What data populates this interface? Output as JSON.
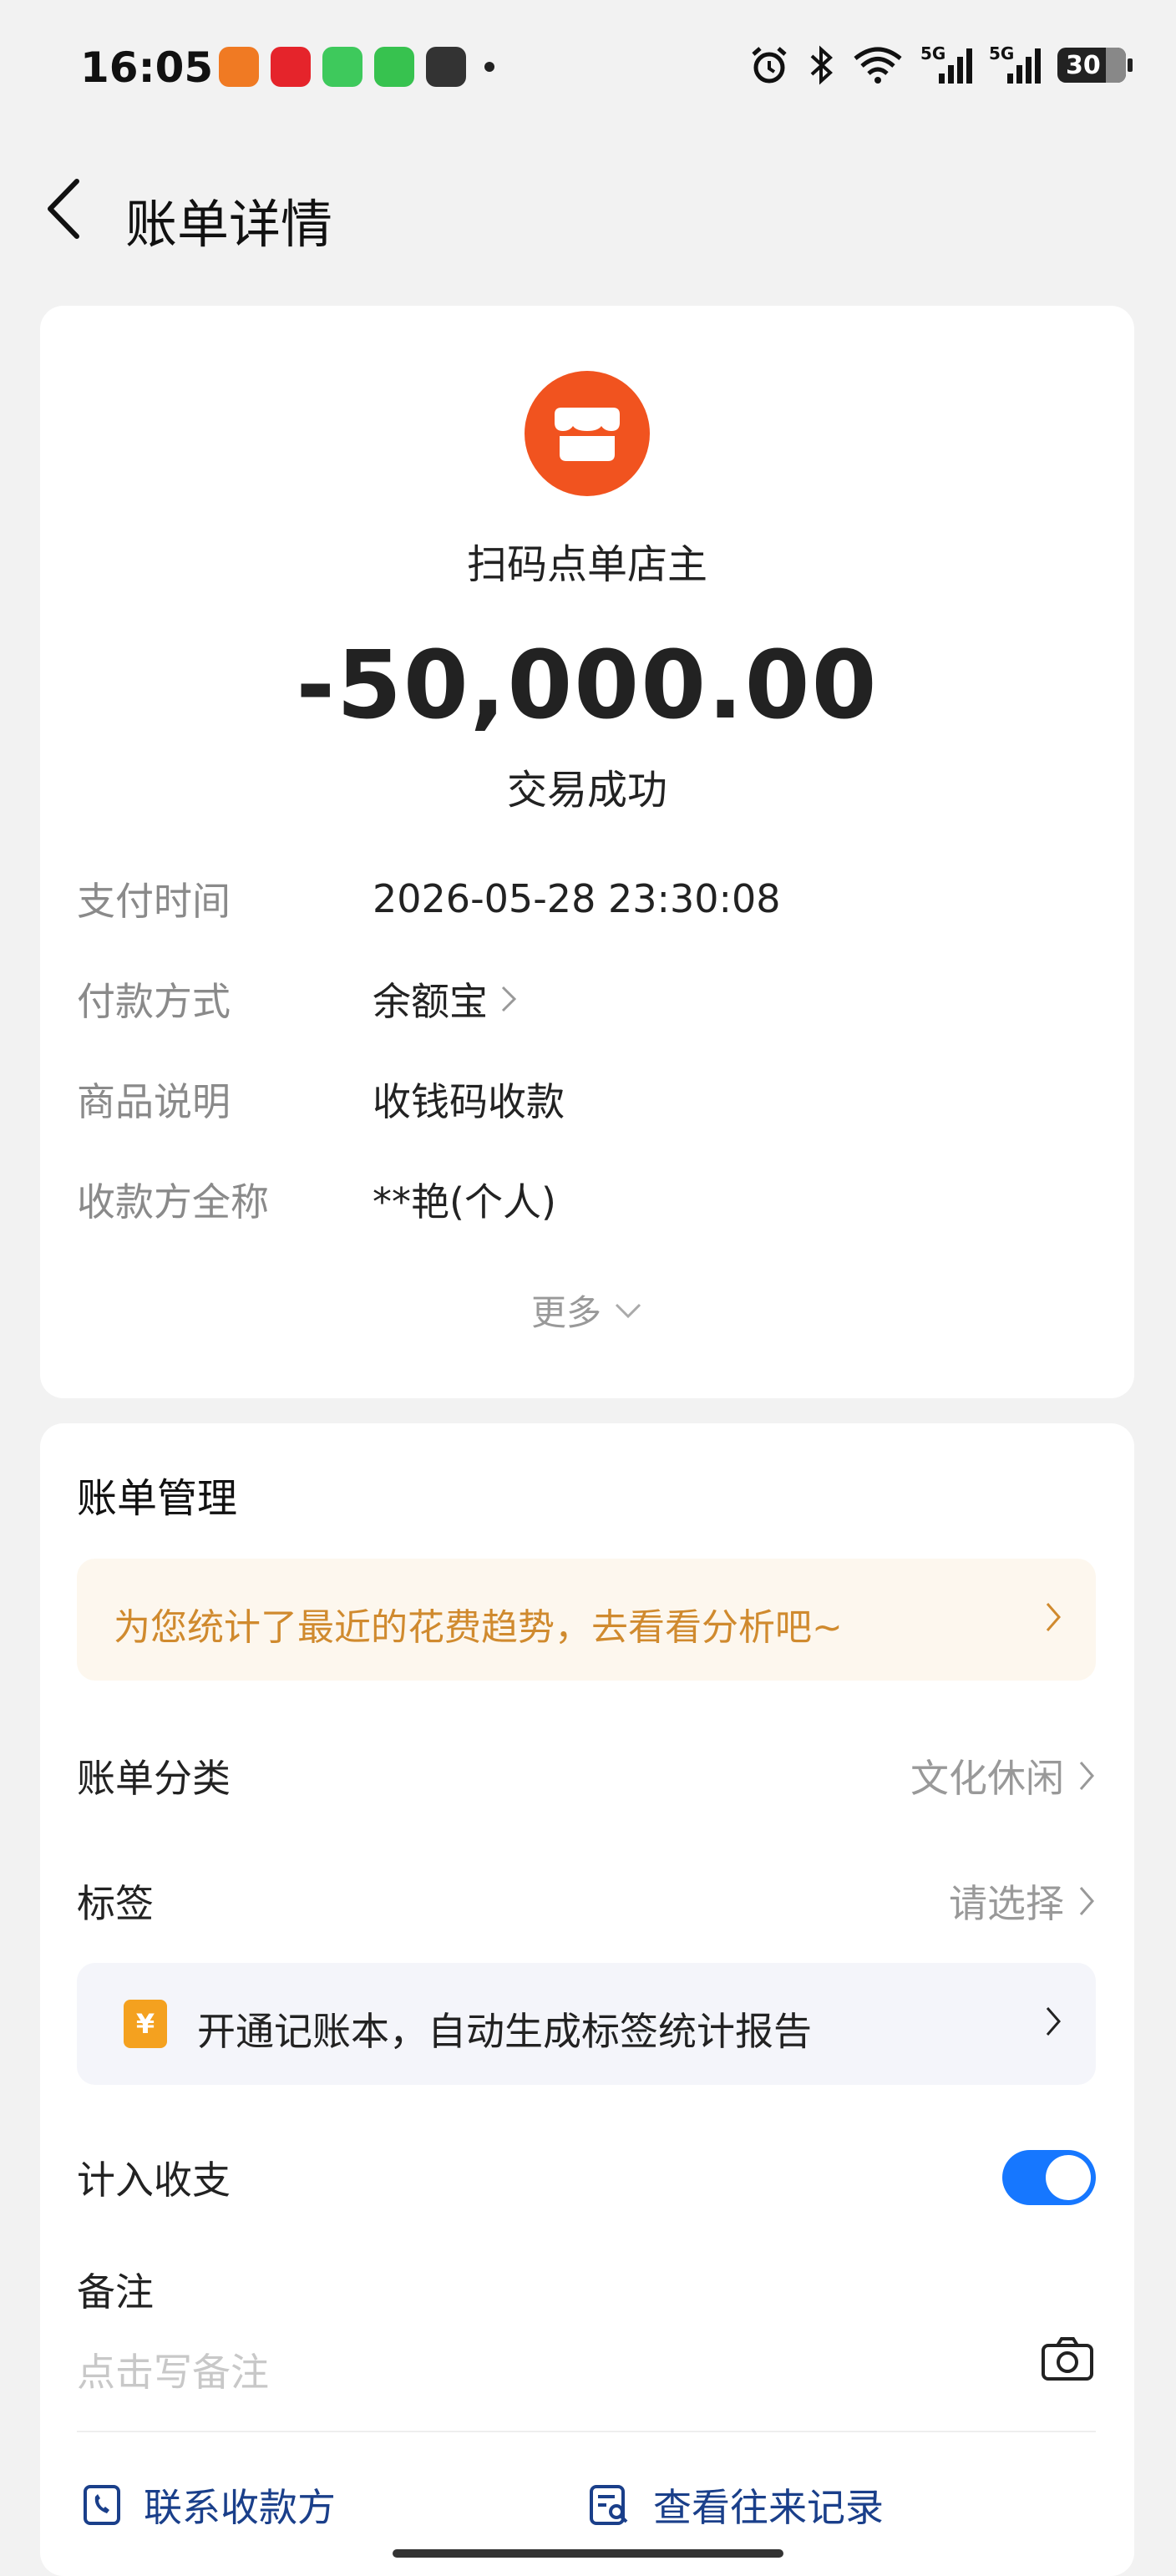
{
  "status_bar": {
    "time": "16:05",
    "signal1_label": "5G",
    "signal2_label": "5G",
    "battery": "30",
    "icons": [
      "alarm-icon",
      "bluetooth-icon",
      "wifi-icon",
      "signal-icon",
      "signal-icon",
      "battery-icon"
    ],
    "app_icons": [
      {
        "name": "video-app-icon",
        "color": "#f07a23"
      },
      {
        "name": "heart-app-icon",
        "color": "#e5242b"
      },
      {
        "name": "phone-app-icon",
        "color": "#3ec95c"
      },
      {
        "name": "message-app-icon",
        "color": "#37c24f"
      },
      {
        "name": "dark-app-icon",
        "color": "#333333"
      }
    ]
  },
  "header": {
    "title": "账单详情"
  },
  "transaction": {
    "merchant": "扫码点单店主",
    "amount": "-50,000.00",
    "status": "交易成功",
    "details": [
      {
        "label": "支付时间",
        "value": "2026-05-28 23:30:08"
      },
      {
        "label": "付款方式",
        "value": "余额宝"
      },
      {
        "label": "商品说明",
        "value": "收钱码收款"
      },
      {
        "label": "收款方全称",
        "value": "**艳(个人)"
      }
    ],
    "more_label": "更多"
  },
  "management": {
    "title": "账单管理",
    "analysis_banner": "为您统计了最近的花费趋势，去看看分析吧~",
    "category_label": "账单分类",
    "category_value": "文化休闲",
    "tag_label": "标签",
    "tag_value": "请选择",
    "ledger_banner": "开通记账本，自动生成标签统计报告",
    "ledger_icon_text": "¥",
    "include_label": "计入收支",
    "include_enabled": true,
    "note_label": "备注",
    "note_placeholder": "点击写备注",
    "contact_label": "联系收款方",
    "history_label": "查看往来记录"
  },
  "colors": {
    "accent": "#1677ff",
    "merchant_icon": "#f1531f",
    "banner_text": "#d08a2e",
    "link_text": "#1a3f8a"
  }
}
